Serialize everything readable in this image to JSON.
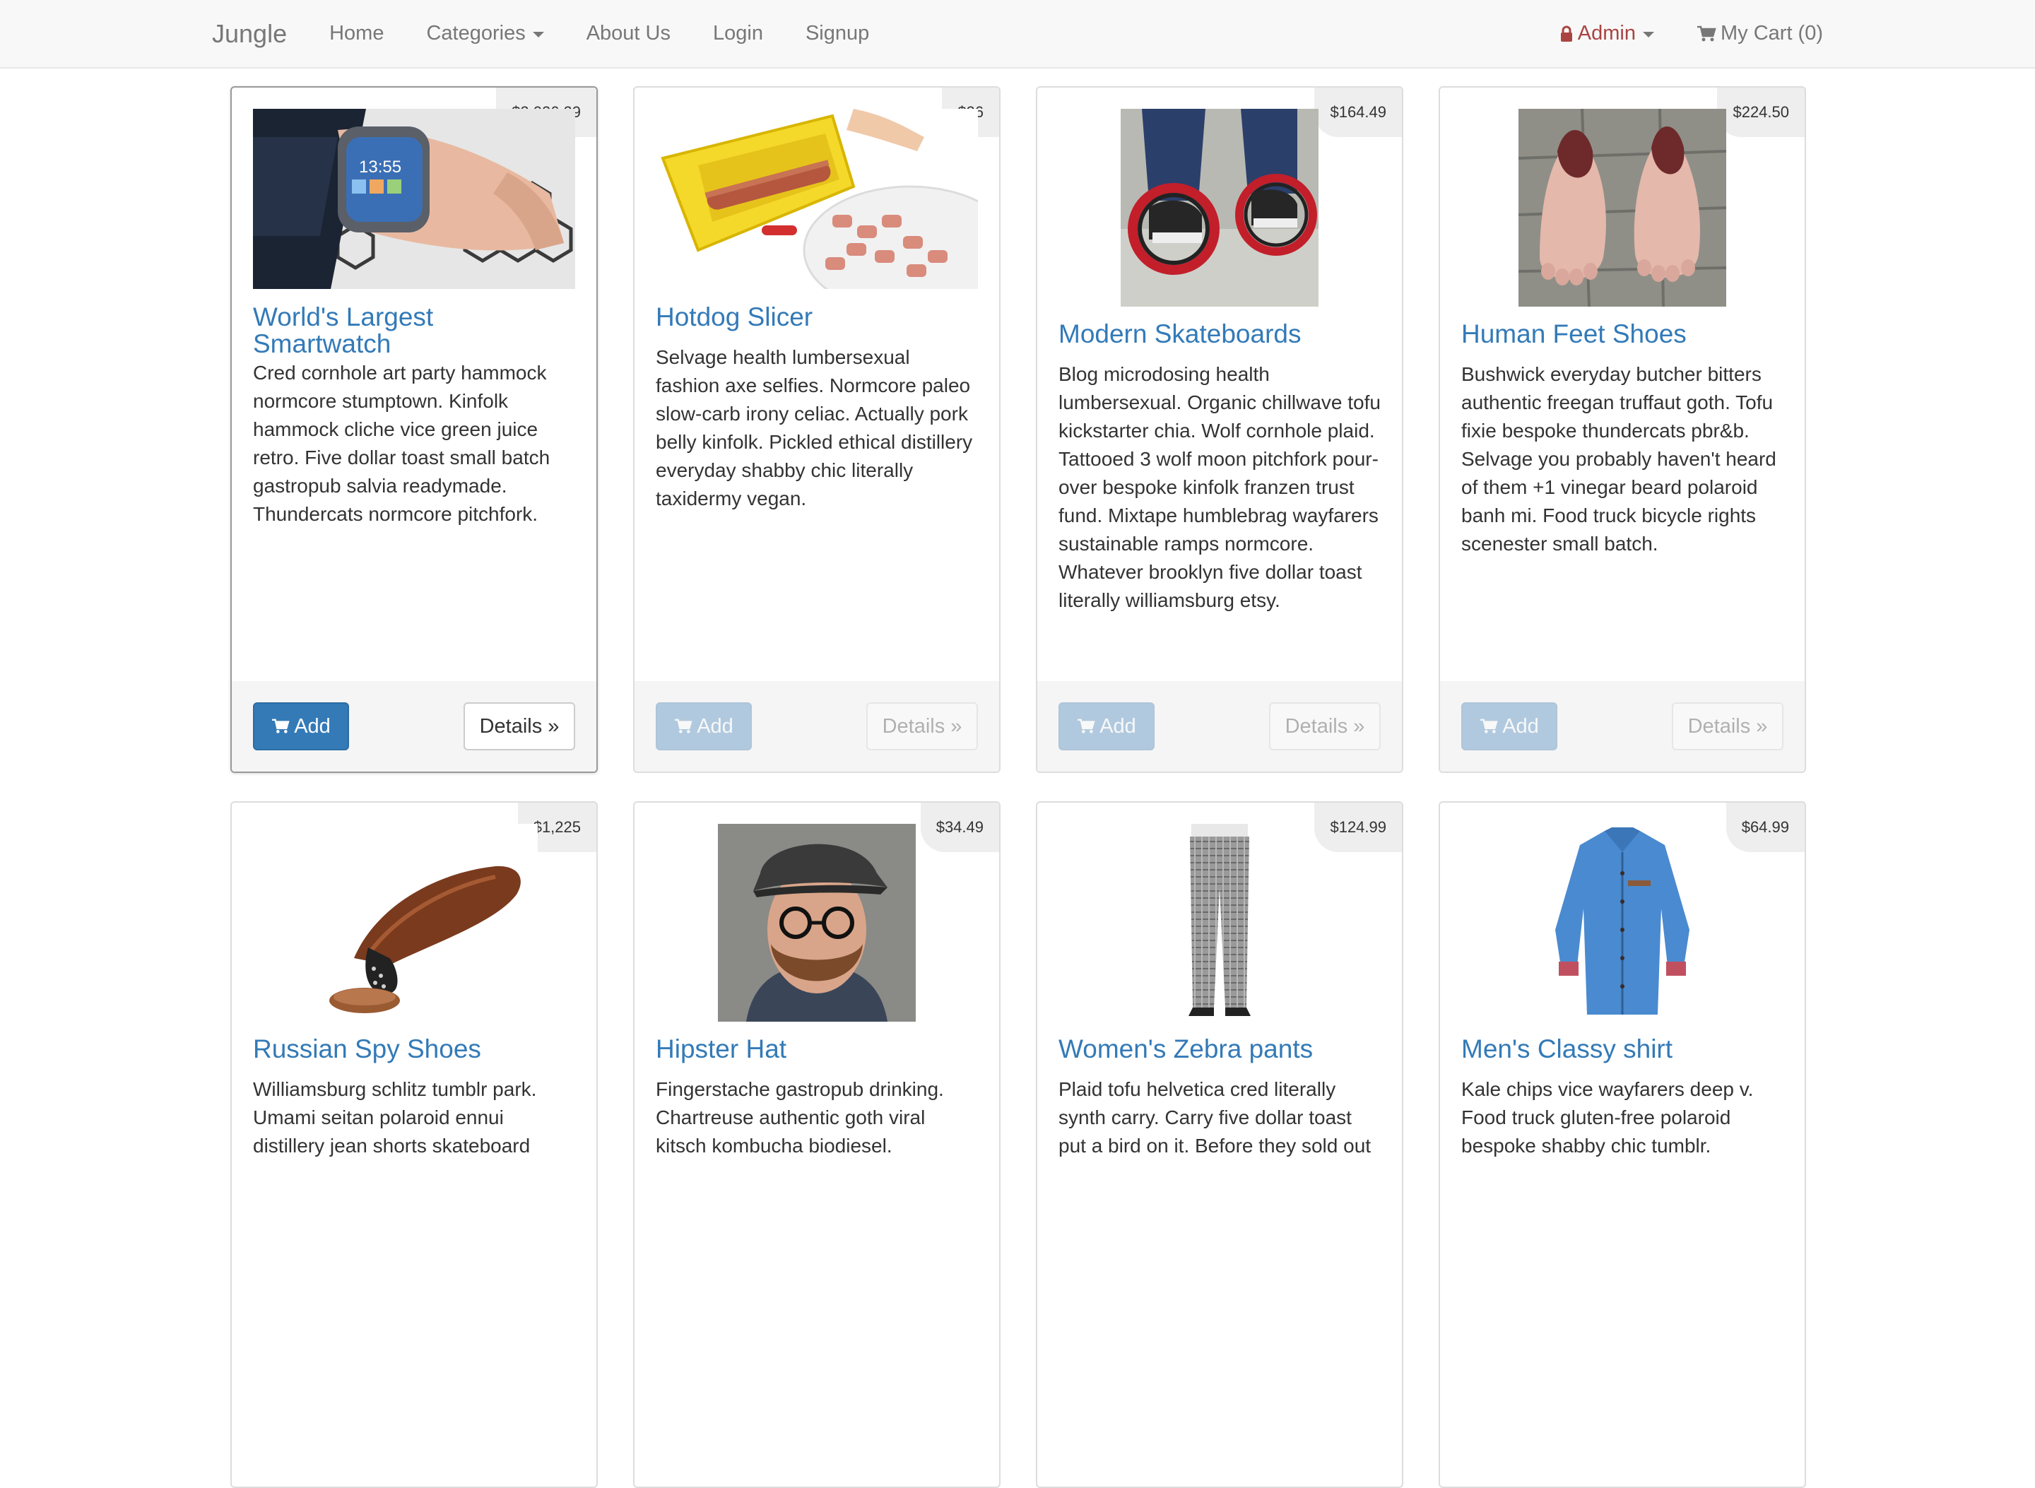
{
  "navbar": {
    "brand": "Jungle",
    "home": "Home",
    "categories": "Categories",
    "about": "About Us",
    "login": "Login",
    "signup": "Signup",
    "admin": "Admin",
    "cart": "My Cart (0)"
  },
  "products": [
    {
      "title": "World's Largest Smartwatch",
      "price": "$2,026.29",
      "description": "Cred cornhole art party hammock normcore stumptown. Kinfolk hammock cliche vice green juice retro. Five dollar toast small batch gastropub salvia readymade. Thundercats normcore pitchfork.",
      "add_label": "Add",
      "details_label": "Details »"
    },
    {
      "title": "Hotdog Slicer",
      "price": "$26",
      "description": "Selvage health lumbersexual fashion axe selfies. Normcore paleo slow-carb irony celiac. Actually pork belly kinfolk. Pickled ethical distillery everyday shabby chic literally taxidermy vegan.",
      "add_label": "Add",
      "details_label": "Details »"
    },
    {
      "title": "Modern Skateboards",
      "price": "$164.49",
      "description": "Blog microdosing health lumbersexual. Organic chillwave tofu kickstarter chia. Wolf cornhole plaid. Tattooed 3 wolf moon pitchfork pour-over bespoke kinfolk franzen trust fund. Mixtape humblebrag wayfarers sustainable ramps normcore. Whatever brooklyn five dollar toast literally williamsburg etsy.",
      "add_label": "Add",
      "details_label": "Details »"
    },
    {
      "title": "Human Feet Shoes",
      "price": "$224.50",
      "description": "Bushwick everyday butcher bitters authentic freegan truffaut goth. Tofu fixie bespoke thundercats pbr&b. Selvage you probably haven't heard of them +1 vinegar beard polaroid banh mi. Food truck bicycle rights scenester small batch.",
      "add_label": "Add",
      "details_label": "Details »"
    },
    {
      "title": "Russian Spy Shoes",
      "price": "$1,225",
      "description": "Williamsburg schlitz tumblr park. Umami seitan polaroid ennui distillery jean shorts skateboard",
      "add_label": "Add",
      "details_label": "Details »"
    },
    {
      "title": "Hipster Hat",
      "price": "$34.49",
      "description": "Fingerstache gastropub drinking. Chartreuse authentic goth viral kitsch kombucha biodiesel.",
      "add_label": "Add",
      "details_label": "Details »"
    },
    {
      "title": "Women's Zebra pants",
      "price": "$124.99",
      "description": "Plaid tofu helvetica cred literally synth carry. Carry five dollar toast put a bird on it. Before they sold out",
      "add_label": "Add",
      "details_label": "Details »"
    },
    {
      "title": "Men's Classy shirt",
      "price": "$64.99",
      "description": "Kale chips vice wayfarers deep v. Food truck gluten-free polaroid bespoke shabby chic tumblr.",
      "add_label": "Add",
      "details_label": "Details »"
    }
  ],
  "colors": {
    "link": "#337ab7",
    "primary": "#337ab7",
    "admin": "#a94442",
    "navbar_bg": "#f8f8f8"
  }
}
